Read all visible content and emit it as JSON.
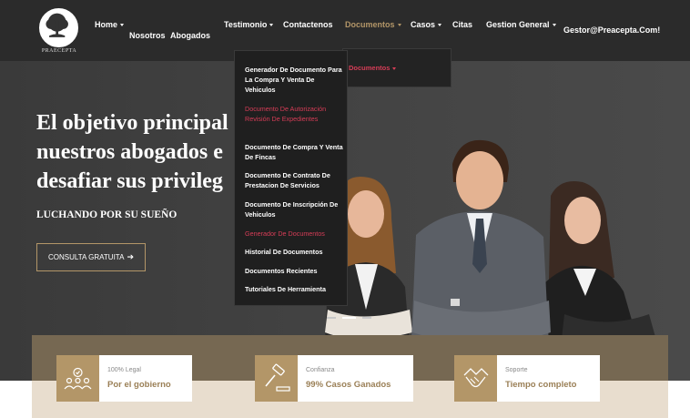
{
  "brand": {
    "logo_text": "PRAECEPTA",
    "accent": "#b39668",
    "highlight": "#d63d57"
  },
  "nav": {
    "home": "Home",
    "nosotros": "Nosotros",
    "abogados": "Abogados",
    "testimonio": "Testimonio",
    "contactenos": "Contactenos",
    "documentos": "Documentos",
    "casos": "Casos",
    "citas": "Citas",
    "gestion": "Gestion General",
    "email": "Gestor@Preacepta.Com!"
  },
  "dropdown": {
    "items": [
      "Generador De Documento Para La Compra Y Venta De Vehiculos",
      "Documento De Autorización Revisión De Expedientes",
      "Documento De Compra Y Venta De Fincas",
      "Documento De Contrato De Prestacion De Servicios",
      "Documento De Inscripción De Vehiculos",
      "Generador De Documentos",
      "Historial De Documentos",
      "Documentos Recientes",
      "Tutoriales De Herramienta"
    ],
    "sub_item": "Documentos"
  },
  "hero": {
    "title_lines": [
      "El objetivo principal",
      "nuestros abogados e",
      "desafiar sus privileg"
    ],
    "subtitle": "LUCHANDO POR SU SUEÑO",
    "cta_label": "CONSULTA GRATUITA",
    "cta_arrow": "➔"
  },
  "features": [
    {
      "small": "100% Legal",
      "big": "Por el gobierno",
      "icon": "people-check-icon"
    },
    {
      "small": "Confianza",
      "big": "99% Casos Ganados",
      "icon": "gavel-icon"
    },
    {
      "small": "Soporte",
      "big": "Tiempo completo",
      "icon": "handshake-icon"
    }
  ]
}
